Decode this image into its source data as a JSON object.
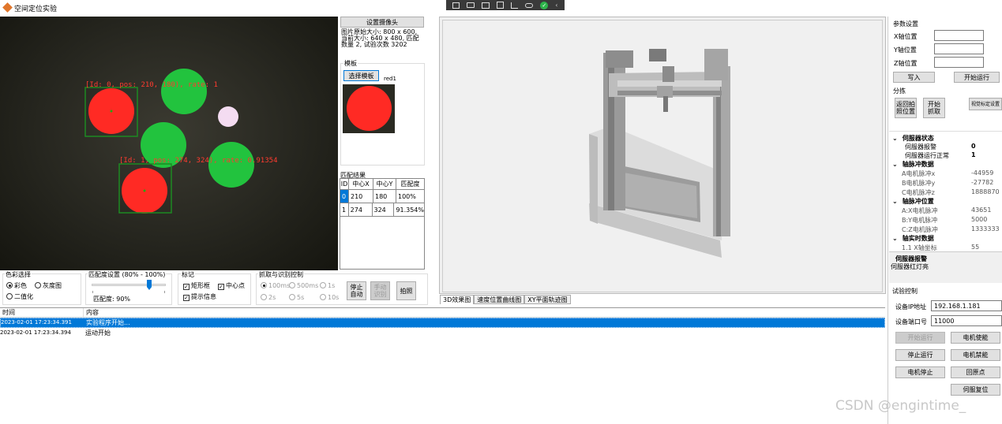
{
  "window": {
    "title": "空间定位实验",
    "accent": "#e0762b"
  },
  "toolbar_icons": [
    "share-icon",
    "camera-icon",
    "monitor-icon",
    "screen-icon",
    "tree-icon",
    "link-icon",
    "check-icon",
    "chevron-left-icon"
  ],
  "camera": {
    "set_button": "设置摄像头",
    "info_line1": "图片原始大小: 800 x 600,",
    "info_line2": "当前大小: 640 x 480, 匹配",
    "info_line3": "数量 2, 试验次数 3202",
    "overlay1": "[Id: 0, pos: 210, 180), rate: 1",
    "overlay2": "[Id: 1, pos: 274, 324), rate: 0.91354"
  },
  "template": {
    "title": "模板",
    "select_button": "选择模板",
    "name": "red1"
  },
  "match": {
    "title": "匹配结果",
    "headers": [
      "ID",
      "中心X",
      "中心Y",
      "匹配度"
    ],
    "rows": [
      [
        "0",
        "210",
        "180",
        "100%"
      ],
      [
        "1",
        "274",
        "324",
        "91.354%"
      ]
    ]
  },
  "color_select": {
    "title": "色彩选择",
    "opt1": "彩色",
    "opt2": "灰度图",
    "opt3": "二值化"
  },
  "match_setting": {
    "title": "匹配度设置 (80% - 100%)",
    "value_label": "匹配度: 90%",
    "slider_value": 90
  },
  "mark": {
    "title": "标记",
    "opt1": "矩形框",
    "opt2": "中心点",
    "opt3": "提示信息"
  },
  "capture": {
    "title": "抓取与识别控制",
    "t1": "100ms",
    "t2": "500ms",
    "t3": "1s",
    "t4": "2s",
    "t5": "5s",
    "t6": "10s",
    "btn_stop": "停止\n自动",
    "btn_manual": "手动\n识别",
    "btn_photo": "拍照"
  },
  "tabs": {
    "t1": "3D效果图",
    "t2": "速度位置曲线图",
    "t3": "XY平面轨迹图"
  },
  "log": {
    "headers": {
      "time": "时间",
      "content": "内容"
    },
    "rows": [
      {
        "time": "2023-02-01 17:23:34.391",
        "content": "实验程序开始..."
      },
      {
        "time": "2023-02-01 17:23:34.394",
        "content": "运动开始"
      }
    ]
  },
  "params": {
    "title": "参数设置",
    "x_label": "X轴位置",
    "y_label": "Y轴位置",
    "z_label": "Z轴位置",
    "write_btn": "写入",
    "start_btn": "开始运行"
  },
  "sort": {
    "title": "分拣",
    "return_btn": "返回拍\n照位置",
    "start_btn": "开始\n抓取",
    "setting_btn": "视觉标定设置"
  },
  "servo": {
    "s1": "伺服器状态",
    "s1_r1_label": "伺服器报警",
    "s1_r1_val": "0",
    "s1_r2_label": "伺服器运行正常",
    "s1_r2_val": "1",
    "s2": "轴脉冲数据",
    "s2_r1_label": "A电机脉冲x",
    "s2_r1_val": "-44959",
    "s2_r2_label": "B电机脉冲y",
    "s2_r2_val": "-27782",
    "s2_r3_label": "C电机脉冲z",
    "s2_r3_val": "1888870",
    "s3": "轴脉冲位置",
    "s3_r1_label": "A:X电机脉冲",
    "s3_r1_val": "43651",
    "s3_r2_label": "B:Y电机脉冲",
    "s3_r2_val": "5000",
    "s3_r3_label": "C:Z电机脉冲",
    "s3_r3_val": "1333333",
    "s4": "轴实时数据",
    "s4_r1_label": "1.1 X轴坐标",
    "s4_r1_val": "55"
  },
  "alarm": {
    "title": "伺服器报警",
    "text": "伺服器红灯亮"
  },
  "experiment": {
    "title": "试验控制",
    "ip_label": "设备IP地址",
    "ip_value": "192.168.1.181",
    "port_label": "设备端口号",
    "port_value": "11000",
    "b1": "开始运行",
    "b2": "电机使能",
    "b3": "停止运行",
    "b4": "电机禁能",
    "b5": "电机停止",
    "b6": "回原点",
    "b7": "伺服复位"
  },
  "watermark": "CSDN @engintime_"
}
